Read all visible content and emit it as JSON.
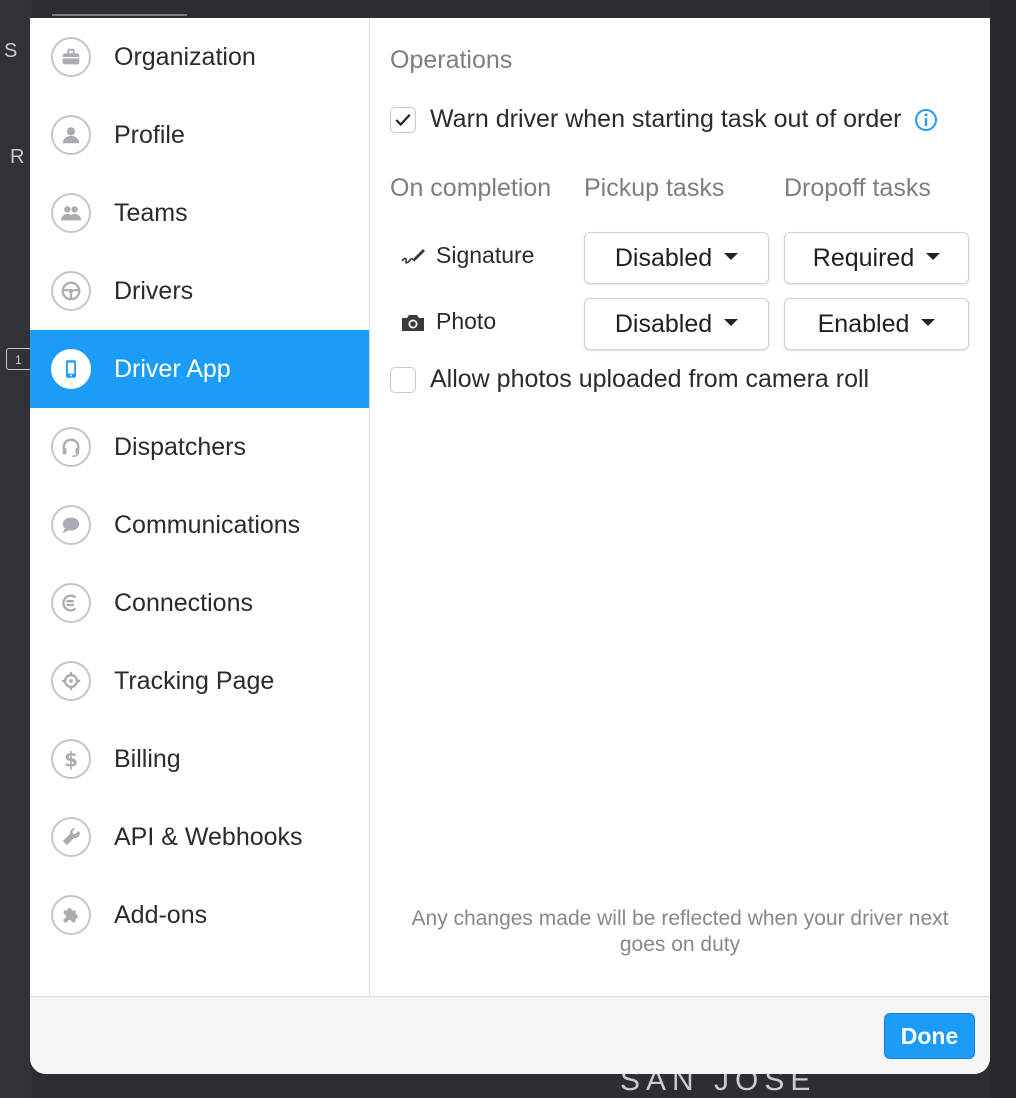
{
  "colors": {
    "accent": "#1b9cf8",
    "muted": "#7b7e82",
    "icon_ring": "#c3c6c9"
  },
  "map": {
    "edge_letters": "S S",
    "edge_letter_r": "R",
    "road_marker": "1",
    "city_label": "SAN JOSE"
  },
  "sidebar": {
    "items": [
      {
        "label": "Organization",
        "icon": "briefcase-icon"
      },
      {
        "label": "Profile",
        "icon": "person-icon"
      },
      {
        "label": "Teams",
        "icon": "group-icon"
      },
      {
        "label": "Drivers",
        "icon": "steering-wheel-icon"
      },
      {
        "label": "Driver App",
        "icon": "phone-icon",
        "active": true
      },
      {
        "label": "Dispatchers",
        "icon": "headset-icon"
      },
      {
        "label": "Communications",
        "icon": "chat-bubble-icon"
      },
      {
        "label": "Connections",
        "icon": "connection-icon"
      },
      {
        "label": "Tracking Page",
        "icon": "target-icon"
      },
      {
        "label": "Billing",
        "icon": "dollar-icon"
      },
      {
        "label": "API & Webhooks",
        "icon": "wrench-icon"
      },
      {
        "label": "Add-ons",
        "icon": "puzzle-icon"
      }
    ]
  },
  "content": {
    "section_title": "Operations",
    "warn_checkbox": {
      "label": "Warn driver when starting task out of order",
      "checked": true
    },
    "columns": {
      "on_completion": "On completion",
      "pickup": "Pickup tasks",
      "dropoff": "Dropoff tasks"
    },
    "rows": [
      {
        "label": "Signature",
        "icon": "signature-icon",
        "pickup": "Disabled",
        "dropoff": "Required"
      },
      {
        "label": "Photo",
        "icon": "camera-icon",
        "pickup": "Disabled",
        "dropoff": "Enabled"
      }
    ],
    "camera_roll_checkbox": {
      "label": "Allow photos uploaded from camera roll",
      "checked": false
    },
    "footnote": "Any changes made will be reflected when your driver next goes on duty"
  },
  "footer": {
    "done_label": "Done"
  }
}
